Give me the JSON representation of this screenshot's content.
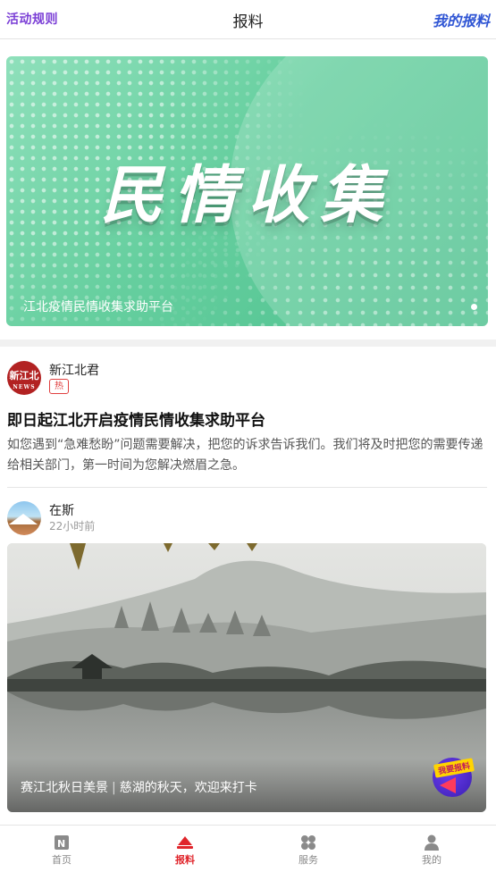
{
  "header": {
    "left_link": "活动规则",
    "title": "报料",
    "right_link": "我的报料"
  },
  "banner": {
    "headline": "民情收集",
    "caption": "江北疫情民情收集求助平台",
    "colors": {
      "start": "#8fe0bb",
      "end": "#4dc08e"
    }
  },
  "posts": [
    {
      "author": "新江北君",
      "avatar_text": "新江北",
      "avatar_sub": "NEWS",
      "badge": "热",
      "title": "即日起江北开启疫情民情收集求助平台",
      "body": "如您遇到“急难愁盼”问题需要解决，把您的诉求告诉我们。我们将及时把您的需要传递给相关部门，第一时间为您解决燃眉之急。"
    },
    {
      "author": "在斯",
      "time": "22小时前",
      "caption_part1": "赛江北秋日美景",
      "caption_sep": "|",
      "caption_part2": "慈湖的秋天，欢迎来打卡",
      "report_tag": "我要报料"
    }
  ],
  "tabs": [
    {
      "label": "首页",
      "icon": "news-icon"
    },
    {
      "label": "报料",
      "icon": "report-icon",
      "active": true
    },
    {
      "label": "服务",
      "icon": "grid-icon"
    },
    {
      "label": "我的",
      "icon": "user-icon"
    }
  ],
  "colors": {
    "accent": "#e0252b",
    "rule_link": "#7b3fd6",
    "my_report": "#2f55d4"
  }
}
